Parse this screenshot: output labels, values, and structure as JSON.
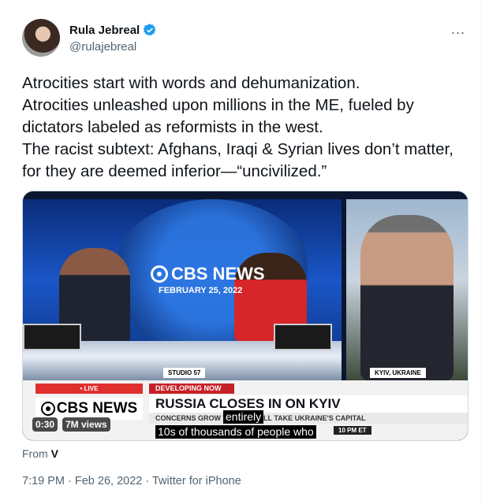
{
  "author": {
    "name": "Rula Jebreal",
    "handle": "@rulajebreal",
    "verified": true,
    "more_icon": "..."
  },
  "tweet": {
    "text": "Atrocities start with words and dehumanization.\nAtrocities unleashed upon millions in the ME, fueled by dictators labeled as reformists in the west.\nThe racist subtext: Afghans, Iraqi & Syrian lives don’t matter, for they are deemed inferior—“uncivilized.”"
  },
  "video": {
    "cbs_logo": "CBS NEWS",
    "cbs_date": "FEBRUARY 25, 2022",
    "studio_tag": "STUDIO 57",
    "location_tag": "KYIV, UKRAINE",
    "live_label": "• LIVE",
    "developing_label": "DEVELOPING NOW",
    "lower_logo": "CBS NEWS",
    "headline": "RUSSIA CLOSES IN ON KYIV",
    "subhead": "CONCERNS GROW TROOPS WILL TAKE UKRAINE'S CAPITAL",
    "time_label": "10 PM ET",
    "caption_line1": "entirely",
    "caption_line2": "10s of thousands of people who",
    "duration": "0:30",
    "views": "7M views"
  },
  "source": {
    "prefix": "From",
    "name": "V"
  },
  "meta": {
    "timestamp": "7:19 PM · Feb 26, 2022 · Twitter for iPhone"
  },
  "colors": {
    "verified": "#1d9bf0",
    "secondary_text": "#536471",
    "live_red": "#e0302e"
  }
}
